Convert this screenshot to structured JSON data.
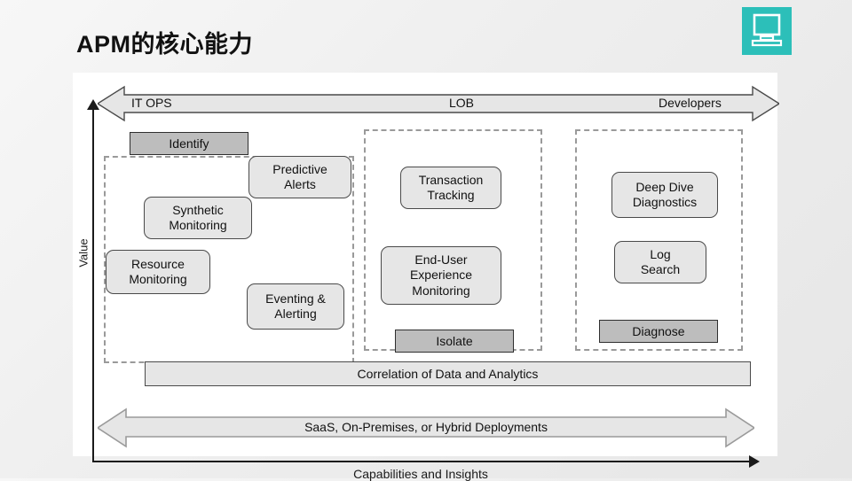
{
  "slide": {
    "title": "APM的核心能力",
    "logo_icon": "computer-monitor-icon",
    "logo_color": "#2cbfb9"
  },
  "diagram": {
    "y_axis_label": "Value",
    "x_axis_label": "Capabilities and Insights",
    "audience_arrow": {
      "left": "IT OPS",
      "middle": "LOB",
      "right": "Developers"
    },
    "stages": [
      {
        "id": "identify",
        "label": "Identify"
      },
      {
        "id": "isolate",
        "label": "Isolate"
      },
      {
        "id": "diagnose",
        "label": "Diagnose"
      }
    ],
    "groups": [
      {
        "id": "itops",
        "capabilities": [
          {
            "id": "predictive-alerts",
            "lines": [
              "Predictive",
              "Alerts"
            ]
          },
          {
            "id": "synthetic-monitoring",
            "lines": [
              "Synthetic",
              "Monitoring"
            ]
          },
          {
            "id": "resource-monitoring",
            "lines": [
              "Resource",
              "Monitoring"
            ]
          },
          {
            "id": "eventing-alerting",
            "lines": [
              "Eventing &",
              "Alerting"
            ]
          }
        ]
      },
      {
        "id": "lob",
        "capabilities": [
          {
            "id": "transaction-tracking",
            "lines": [
              "Transaction",
              "Tracking"
            ]
          },
          {
            "id": "end-user-experience-monitoring",
            "lines": [
              "End-User",
              "Experience",
              "Monitoring"
            ]
          }
        ]
      },
      {
        "id": "developers",
        "capabilities": [
          {
            "id": "deep-dive-diagnostics",
            "lines": [
              "Deep Dive",
              "Diagnostics"
            ]
          },
          {
            "id": "log-search",
            "lines": [
              "Log",
              "Search"
            ]
          }
        ]
      }
    ],
    "correlation_bar": "Correlation of Data and Analytics",
    "deployment_arrow": "SaaS, On-Premises, or Hybrid Deployments"
  },
  "colors": {
    "logo_teal": "#2cbfb9",
    "stage_gray": "#bdbdbd",
    "box_gray": "#e6e6e6",
    "dash_gray": "#9a9a9a",
    "ink": "#111111"
  }
}
